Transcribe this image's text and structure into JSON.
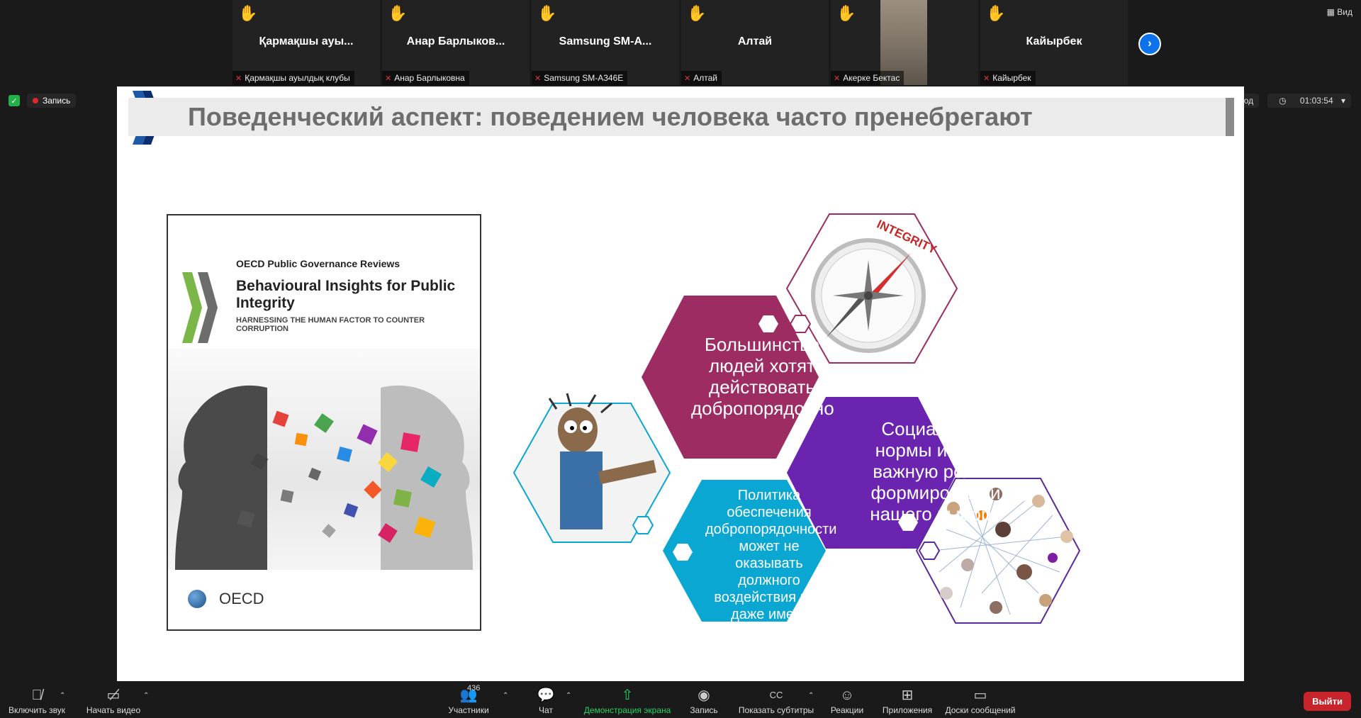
{
  "participants": [
    {
      "name": "Қармақшы ауы...",
      "label": "Қармақшы ауылдық клубы"
    },
    {
      "name": "Анар  Барлыков...",
      "label": "Анар Барлыковна"
    },
    {
      "name": "Samsung  SM-A...",
      "label": "Samsung SM-A346E"
    },
    {
      "name": "Алтай",
      "label": "Алтай"
    },
    {
      "name": "",
      "label": "Акерке Бектас"
    },
    {
      "name": "Кайырбек",
      "label": "Кайырбек"
    }
  ],
  "header": {
    "view_label": "Вид",
    "record_label": "Запись",
    "signin_label": "Вход",
    "timer": "01:03:54"
  },
  "slide": {
    "title": "Поведенческий аспект: поведением человека часто пренебрегают",
    "book": {
      "series": "OECD Public Governance Reviews",
      "title": "Behavioural Insights for Public Integrity",
      "subtitle": "HARNESSING THE HUMAN FACTOR TO COUNTER CORRUPTION",
      "publisher": "OECD"
    },
    "compass_label": "INTEGRITY",
    "hex1": "Большинство людей хотят действовать добропорядочно",
    "hex2": "Социальные нормы играют важную роль в формировании нашего выбора",
    "hex3": "Политика обеспечения добропорядочности может не оказывать должного воздействия или даже иметь неприятные последствия"
  },
  "toolbar": {
    "unmute": "Включить звук",
    "start_video": "Начать видео",
    "participants": "Участники",
    "participants_count": "436",
    "chat": "Чат",
    "share": "Демонстрация экрана",
    "record": "Запись",
    "captions": "Показать субтитры",
    "reactions": "Реакции",
    "apps": "Приложения",
    "whiteboards": "Доски сообщений",
    "leave": "Выйти"
  },
  "colors": {
    "hex_magenta": "#9c2c62",
    "hex_purple": "#6a24b0",
    "hex_cyan": "#0aa7d3",
    "leave_red": "#c9232b",
    "accent_blue": "#0e72ed"
  }
}
